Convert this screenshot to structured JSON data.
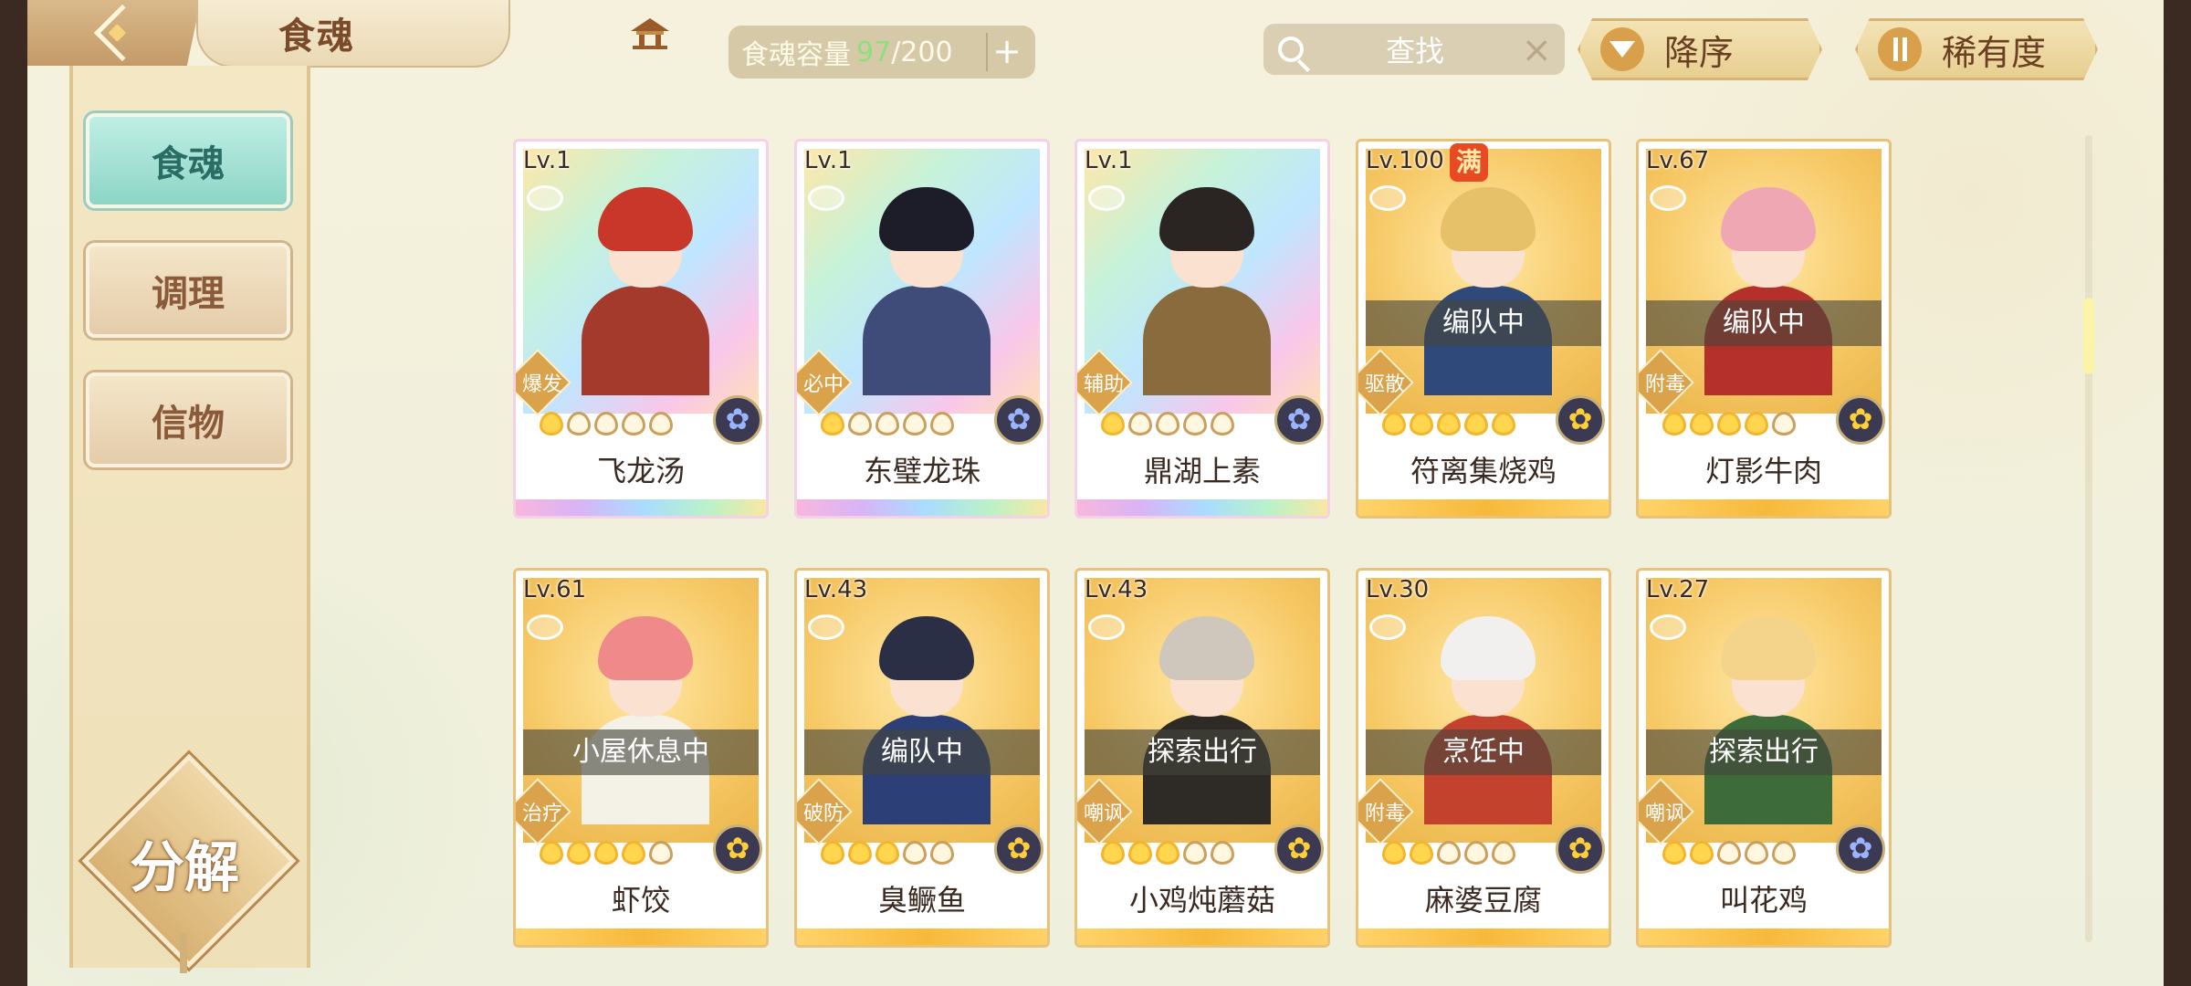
{
  "header": {
    "title": "食魂",
    "capacity_label": "食魂容量",
    "capacity_current": "97",
    "capacity_separator": "/",
    "capacity_max": "200",
    "capacity_add": "+",
    "search_label": "查找",
    "search_clear": "×",
    "sort_order_label": "降序",
    "sort_key_label": "稀有度"
  },
  "sidebar": {
    "items": [
      {
        "label": "食魂"
      },
      {
        "label": "调理"
      },
      {
        "label": "信物"
      }
    ],
    "decompose_label": "分解"
  },
  "cards": [
    {
      "level": "Lv.1",
      "name": "飞龙汤",
      "role": "爆发",
      "status": "",
      "max": false,
      "frame": "rainbow",
      "flames_on": 1,
      "flames_total": 5,
      "rarity": "blue",
      "hair": "#c9372a",
      "body": "#a33a2b"
    },
    {
      "level": "Lv.1",
      "name": "东璧龙珠",
      "role": "必中",
      "status": "",
      "max": false,
      "frame": "rainbow",
      "flames_on": 1,
      "flames_total": 5,
      "rarity": "blue",
      "hair": "#1d1d2a",
      "body": "#3f4c7a"
    },
    {
      "level": "Lv.1",
      "name": "鼎湖上素",
      "role": "辅助",
      "status": "",
      "max": false,
      "frame": "rainbow",
      "flames_on": 1,
      "flames_total": 5,
      "rarity": "blue",
      "hair": "#2a2522",
      "body": "#8a6b3d"
    },
    {
      "level": "Lv.100",
      "name": "符离集烧鸡",
      "role": "驱散",
      "status": "编队中",
      "max": true,
      "max_text": "满",
      "frame": "gold",
      "flames_on": 5,
      "flames_total": 5,
      "rarity": "gold",
      "hair": "#e7c06a",
      "body": "#2f4a7a"
    },
    {
      "level": "Lv.67",
      "name": "灯影牛肉",
      "role": "附毒",
      "status": "编队中",
      "max": false,
      "frame": "gold",
      "flames_on": 4,
      "flames_total": 5,
      "rarity": "gold",
      "hair": "#f0a7b4",
      "body": "#b5302a"
    },
    {
      "level": "Lv.61",
      "name": "虾饺",
      "role": "治疗",
      "status": "小屋休息中",
      "max": false,
      "frame": "gold",
      "flames_on": 4,
      "flames_total": 5,
      "rarity": "gold",
      "hair": "#f08a8a",
      "body": "#f4f1e6"
    },
    {
      "level": "Lv.43",
      "name": "臭鳜鱼",
      "role": "破防",
      "status": "编队中",
      "max": false,
      "frame": "gold",
      "flames_on": 3,
      "flames_total": 5,
      "rarity": "gold",
      "hair": "#2b2f45",
      "body": "#2c3f77"
    },
    {
      "level": "Lv.43",
      "name": "小鸡炖蘑菇",
      "role": "嘲讽",
      "status": "探索出行",
      "max": false,
      "frame": "gold",
      "flames_on": 3,
      "flames_total": 5,
      "rarity": "gold",
      "hair": "#cfc7bb",
      "body": "#2e2a26"
    },
    {
      "level": "Lv.30",
      "name": "麻婆豆腐",
      "role": "附毒",
      "status": "烹饪中",
      "max": false,
      "frame": "gold",
      "flames_on": 2,
      "flames_total": 5,
      "rarity": "gold",
      "hair": "#f2f0ee",
      "body": "#c2422d"
    },
    {
      "level": "Lv.27",
      "name": "叫花鸡",
      "role": "嘲讽",
      "status": "探索出行",
      "max": false,
      "frame": "gold",
      "flames_on": 2,
      "flames_total": 5,
      "rarity": "blue",
      "hair": "#f3d48a",
      "body": "#3d6b3a"
    }
  ]
}
